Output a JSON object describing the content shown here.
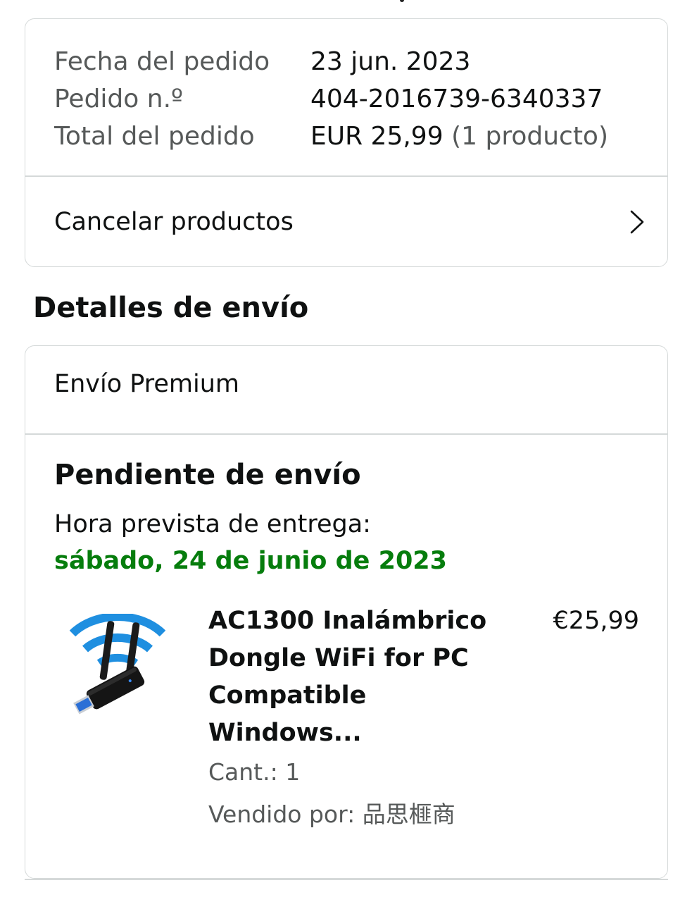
{
  "order_summary": {
    "rows": [
      {
        "label": "Fecha del pedido",
        "value": "23 jun. 2023"
      },
      {
        "label": "Pedido n.º",
        "value": "404-2016739-6340337"
      },
      {
        "label": "Total del pedido",
        "value": "EUR 25,99",
        "extra": "(1 producto)"
      }
    ],
    "cancel_label": "Cancelar productos",
    "cancel_icon": "chevron-right-icon"
  },
  "shipping": {
    "section_title": "Detalles de envío",
    "method": "Envío Premium",
    "status": "Pendiente de envío",
    "eta_label": "Hora prevista de entrega:",
    "eta_date": "sábado, 24 de junio de 2023",
    "eta_color": "#067d0d"
  },
  "product": {
    "image_icon": "usb-wifi-adapter-image",
    "title": "AC1300 Inalámbrico Dongle WiFi for PC Compatible Windows...",
    "price": "€25,99",
    "quantity": "Cant.: 1",
    "seller": "Vendido por: 品思榧商"
  },
  "colors": {
    "text_primary": "#0f1111",
    "text_secondary": "#565959",
    "border": "#d5d9d9",
    "wifi_blue": "#1f8fe0"
  }
}
